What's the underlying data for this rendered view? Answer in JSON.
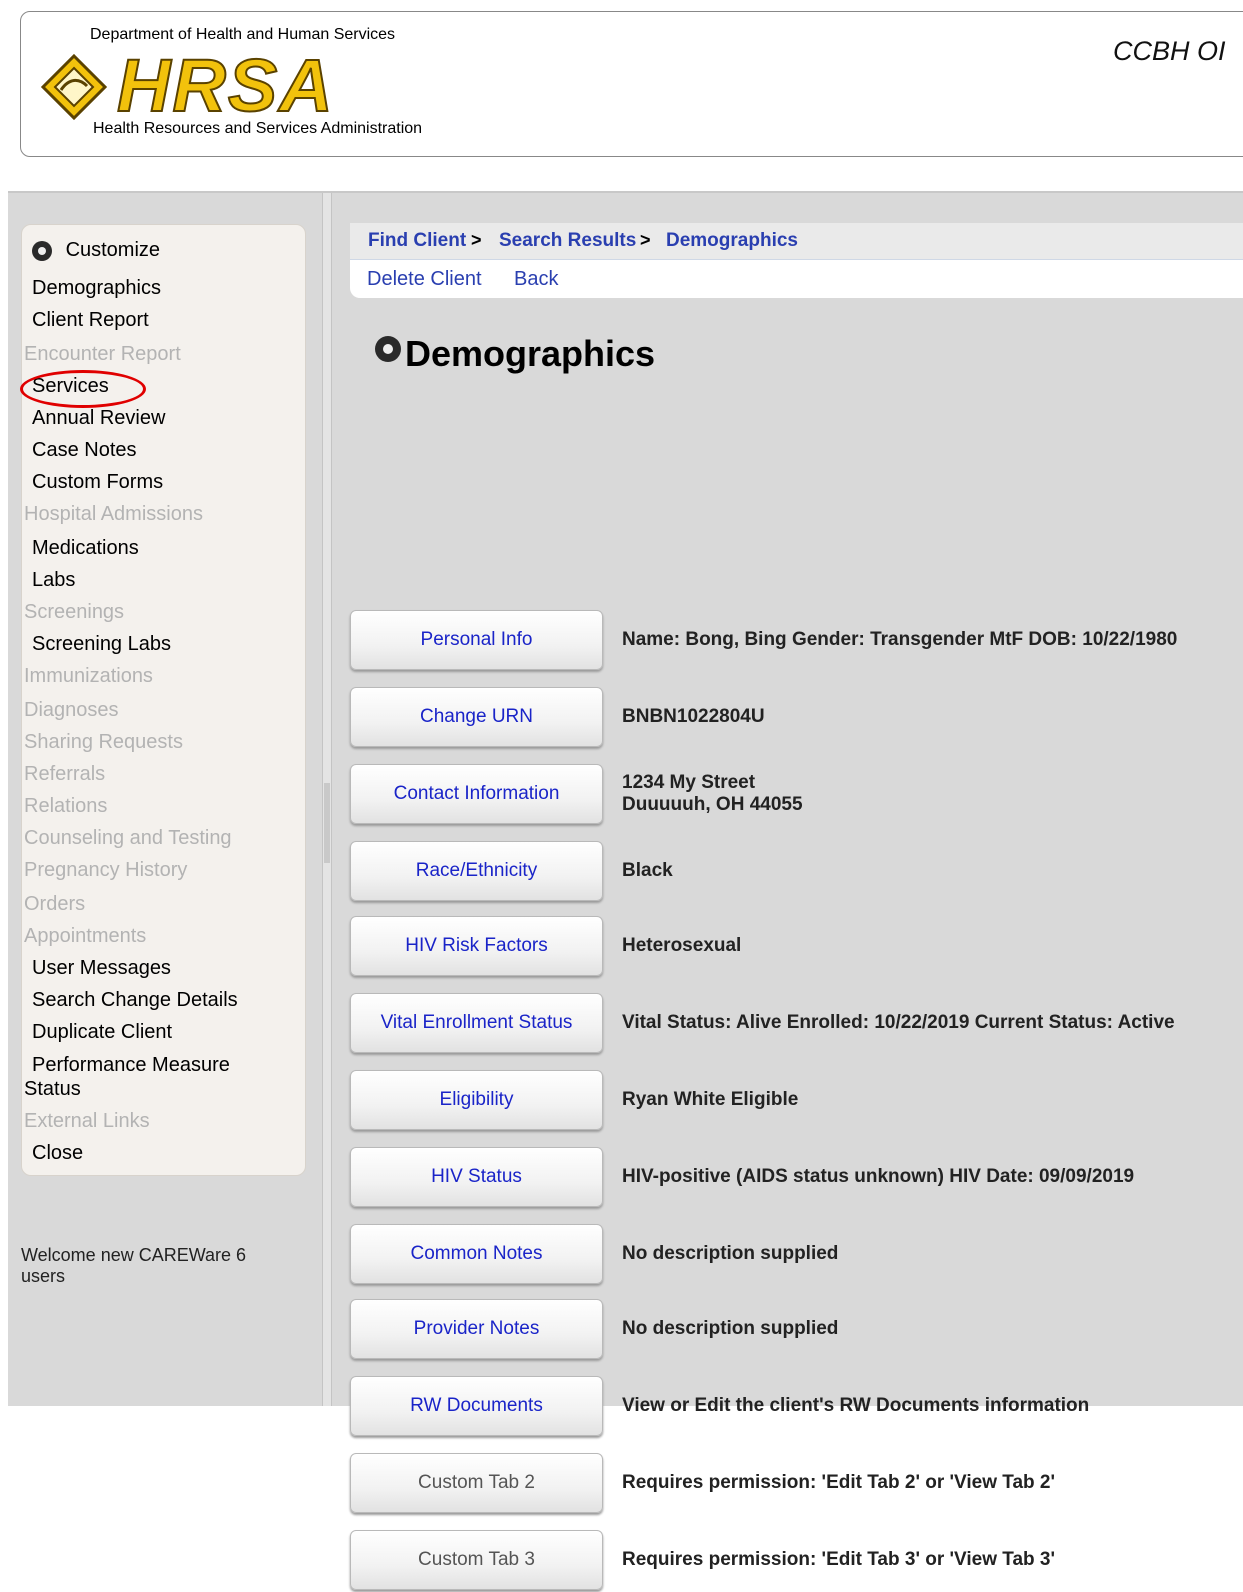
{
  "header": {
    "dept": "Department of Health and Human Services",
    "logo": "HRSA",
    "subtitle": "Health Resources and Services Administration",
    "app_title": "CCBH OI"
  },
  "nav": {
    "items": [
      {
        "label": "Customize",
        "enabled": true
      },
      {
        "label": "Demographics",
        "enabled": true
      },
      {
        "label": "Client Report",
        "enabled": true
      },
      {
        "label": "Encounter Report",
        "enabled": false
      },
      {
        "label": "Services",
        "enabled": true
      },
      {
        "label": "Annual Review",
        "enabled": true
      },
      {
        "label": "Case Notes",
        "enabled": true
      },
      {
        "label": "Custom Forms",
        "enabled": true
      },
      {
        "label": "Hospital Admissions",
        "enabled": false
      },
      {
        "label": "Medications",
        "enabled": true
      },
      {
        "label": "Labs",
        "enabled": true
      },
      {
        "label": "Screenings",
        "enabled": false
      },
      {
        "label": "Screening Labs",
        "enabled": true
      },
      {
        "label": "Immunizations",
        "enabled": false
      },
      {
        "label": "Diagnoses",
        "enabled": false
      },
      {
        "label": "Sharing Requests",
        "enabled": false
      },
      {
        "label": "Referrals",
        "enabled": false
      },
      {
        "label": "Relations",
        "enabled": false
      },
      {
        "label": "Counseling and Testing",
        "enabled": false
      },
      {
        "label": "Pregnancy History",
        "enabled": false
      },
      {
        "label": "Orders",
        "enabled": false
      },
      {
        "label": "Appointments",
        "enabled": false
      },
      {
        "label": "User Messages",
        "enabled": true
      },
      {
        "label": "Search Change Details",
        "enabled": true
      },
      {
        "label": "Duplicate Client",
        "enabled": true
      },
      {
        "label": "Performance Measure",
        "enabled": true
      },
      {
        "label": "Status",
        "enabled": true
      },
      {
        "label": "External Links",
        "enabled": false
      },
      {
        "label": "Close",
        "enabled": true
      }
    ],
    "welcome": "Welcome new CAREWare 6 users"
  },
  "breadcrumb": {
    "items": [
      "Find Client",
      "Search Results",
      "Demographics"
    ],
    "separator": ">"
  },
  "actions": {
    "delete_client": "Delete Client",
    "back": "Back"
  },
  "page": {
    "title": "Demographics"
  },
  "rows": [
    {
      "button": "Personal Info",
      "enabled": true,
      "value": [
        "Name: Bong, Bing Gender: Transgender MtF DOB: 10/22/1980"
      ]
    },
    {
      "button": "Change URN",
      "enabled": true,
      "value": [
        "BNBN1022804U"
      ]
    },
    {
      "button": "Contact Information",
      "enabled": true,
      "value": [
        "1234 My Street",
        "Duuuuuh, OH 44055"
      ]
    },
    {
      "button": "Race/Ethnicity",
      "enabled": true,
      "value": [
        "Black"
      ]
    },
    {
      "button": "HIV Risk Factors",
      "enabled": true,
      "value": [
        "Heterosexual"
      ]
    },
    {
      "button": "Vital Enrollment Status",
      "enabled": true,
      "value": [
        "Vital Status: Alive Enrolled: 10/22/2019 Current Status: Active"
      ]
    },
    {
      "button": "Eligibility",
      "enabled": true,
      "value": [
        "Ryan White Eligible"
      ]
    },
    {
      "button": "HIV Status",
      "enabled": true,
      "value": [
        "HIV-positive (AIDS status unknown) HIV Date: 09/09/2019"
      ]
    },
    {
      "button": "Common Notes",
      "enabled": true,
      "value": [
        "No description supplied"
      ]
    },
    {
      "button": "Provider Notes",
      "enabled": true,
      "value": [
        "No description supplied"
      ]
    },
    {
      "button": "RW Documents",
      "enabled": true,
      "value": [
        "View or Edit the client's RW Documents information"
      ]
    },
    {
      "button": "Custom Tab 2",
      "enabled": false,
      "value": [
        "Requires permission: 'Edit Tab 2' or 'View Tab 2'"
      ]
    },
    {
      "button": "Custom Tab 3",
      "enabled": false,
      "value": [
        "Requires permission: 'Edit Tab 3' or 'View Tab 3'"
      ]
    }
  ],
  "colors": {
    "link": "#2a3fb0",
    "disabled_nav": "#b3b3b3",
    "highlight": "#e00000",
    "logo_gold": "#f2c20c"
  }
}
